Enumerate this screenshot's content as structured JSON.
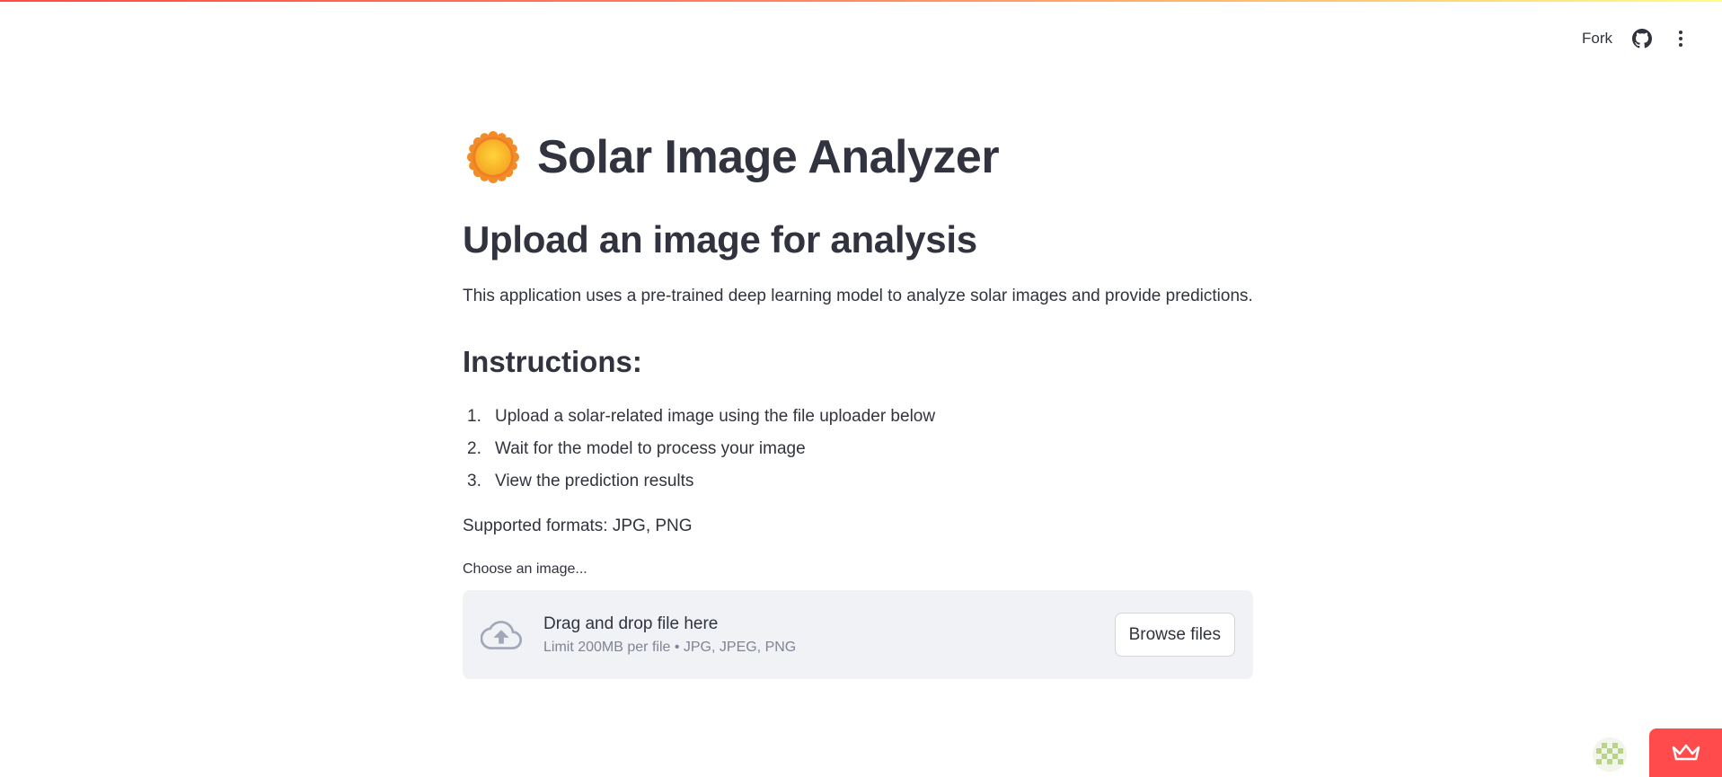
{
  "header": {
    "fork_label": "Fork",
    "github_icon": "github-icon",
    "menu_icon": "more-vertical-icon"
  },
  "main": {
    "title_icon": "sun-icon",
    "title": "Solar Image Analyzer",
    "subheader": "Upload an image for analysis",
    "description": "This application uses a pre-trained deep learning model to analyze solar images and provide predictions.",
    "instructions_title": "Instructions:",
    "steps": [
      {
        "num": "1.",
        "text": "Upload a solar-related image using the file uploader below"
      },
      {
        "num": "2.",
        "text": "Wait for the model to process your image"
      },
      {
        "num": "3.",
        "text": "View the prediction results"
      }
    ],
    "formats": "Supported formats: JPG, PNG"
  },
  "uploader": {
    "label": "Choose an image...",
    "icon": "cloud-upload-icon",
    "drop_text": "Drag and drop file here",
    "limit_text": "Limit 200MB per file • JPG, JPEG, PNG",
    "browse_label": "Browse files"
  },
  "footer": {
    "avatar_icon": "pixel-avatar-icon",
    "badge_icon": "crown-icon"
  },
  "colors": {
    "accent": "#ff4b4b",
    "text": "#31333f",
    "muted": "#808495",
    "dropzone_bg": "#f0f2f6"
  }
}
